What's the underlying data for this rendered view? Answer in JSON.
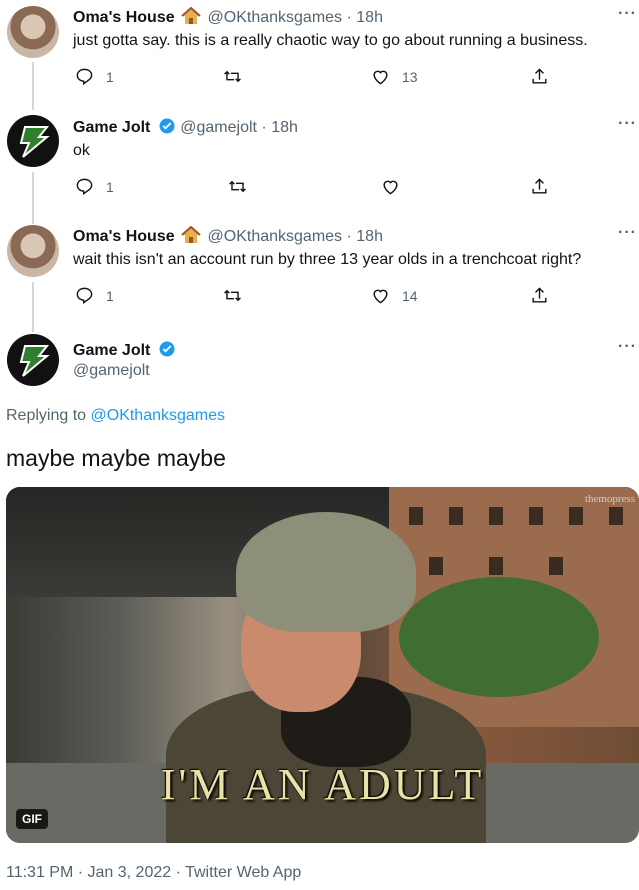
{
  "tweets": [
    {
      "name": "Oma's House",
      "handle": "@OKthanksgames",
      "time": "18h",
      "text": "just gotta say. this is a really chaotic way to go about running a business.",
      "replies": "1",
      "likes": "13"
    },
    {
      "name": "Game Jolt",
      "handle": "@gamejolt",
      "time": "18h",
      "text": "ok",
      "replies": "1",
      "likes": ""
    },
    {
      "name": "Oma's House",
      "handle": "@OKthanksgames",
      "time": "18h",
      "text": "wait this isn't an account run by three 13 year olds in a trenchcoat right?",
      "replies": "1",
      "likes": "14"
    }
  ],
  "main": {
    "name": "Game Jolt",
    "handle": "@gamejolt",
    "replying_prefix": "Replying to ",
    "replying_handle": "@OKthanksgames",
    "text": "maybe maybe maybe",
    "media_caption": "I'M AN ADULT",
    "media_watermark": "themopress",
    "gif_badge": "GIF",
    "footer": "11:31 PM · Jan 3, 2022 · Twitter Web App"
  },
  "ui": {
    "separator": " · ",
    "more": "···"
  },
  "colors": {
    "accent": "#1d9bf0",
    "muted": "#536471",
    "text": "#0f1419",
    "thread_line": "#cfd9de"
  },
  "icons": [
    "reply-icon",
    "retweet-icon",
    "like-icon",
    "share-icon",
    "verified-icon",
    "house-emoji-icon",
    "more-icon"
  ]
}
